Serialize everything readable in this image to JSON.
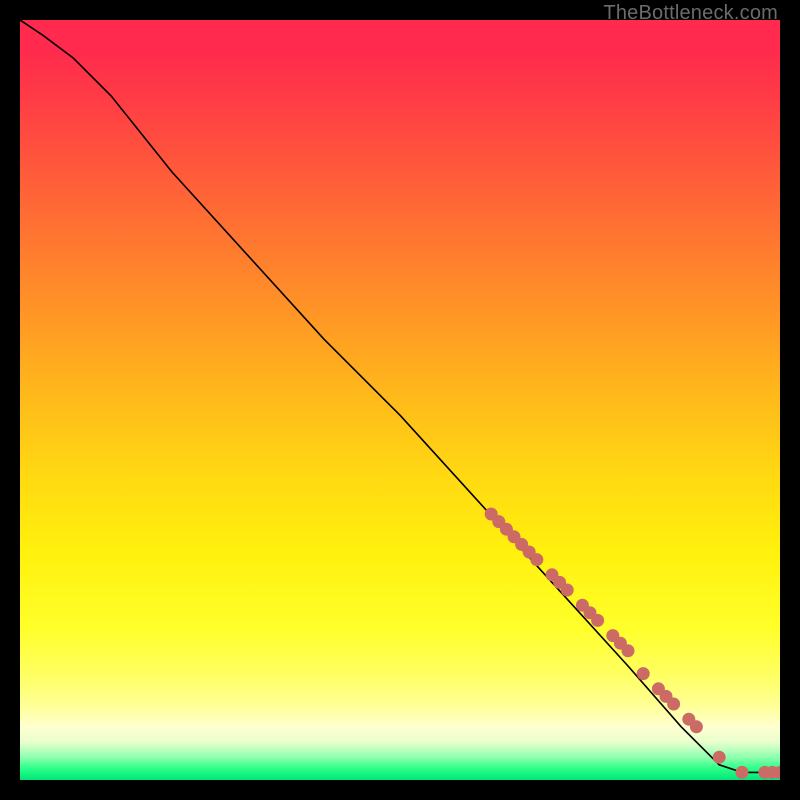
{
  "watermark": "TheBottleneck.com",
  "chart_data": {
    "type": "line",
    "title": "",
    "xlabel": "",
    "ylabel": "",
    "xlim": [
      0,
      100
    ],
    "ylim": [
      0,
      100
    ],
    "grid": false,
    "legend": false,
    "series": [
      {
        "name": "curve",
        "x": [
          0,
          3,
          7,
          12,
          20,
          30,
          40,
          50,
          60,
          70,
          80,
          87,
          92,
          95,
          97,
          100
        ],
        "y": [
          100,
          98,
          95,
          90,
          80,
          69,
          58,
          48,
          37,
          26,
          15,
          7,
          2,
          1,
          1,
          1
        ]
      }
    ],
    "scatter": {
      "name": "points",
      "color": "#cc6b66",
      "points": [
        {
          "x": 62,
          "y": 35
        },
        {
          "x": 63,
          "y": 34
        },
        {
          "x": 64,
          "y": 33
        },
        {
          "x": 65,
          "y": 32
        },
        {
          "x": 66,
          "y": 31
        },
        {
          "x": 67,
          "y": 30
        },
        {
          "x": 68,
          "y": 29
        },
        {
          "x": 70,
          "y": 27
        },
        {
          "x": 71,
          "y": 26
        },
        {
          "x": 72,
          "y": 25
        },
        {
          "x": 74,
          "y": 23
        },
        {
          "x": 75,
          "y": 22
        },
        {
          "x": 76,
          "y": 21
        },
        {
          "x": 78,
          "y": 19
        },
        {
          "x": 79,
          "y": 18
        },
        {
          "x": 80,
          "y": 17
        },
        {
          "x": 82,
          "y": 14
        },
        {
          "x": 84,
          "y": 12
        },
        {
          "x": 85,
          "y": 11
        },
        {
          "x": 86,
          "y": 10
        },
        {
          "x": 88,
          "y": 8
        },
        {
          "x": 89,
          "y": 7
        },
        {
          "x": 92,
          "y": 3
        },
        {
          "x": 95,
          "y": 1
        },
        {
          "x": 98,
          "y": 1
        },
        {
          "x": 99,
          "y": 1
        },
        {
          "x": 100,
          "y": 1
        }
      ]
    }
  }
}
